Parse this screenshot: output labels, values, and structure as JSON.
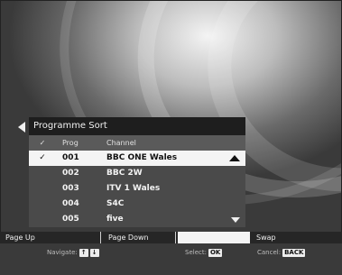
{
  "panel": {
    "title": "Programme Sort",
    "columns": {
      "check": "✓",
      "prog": "Prog",
      "channel": "Channel"
    },
    "rows": [
      {
        "check": "✓",
        "prog": "001",
        "channel": "BBC ONE Wales",
        "selected": true
      },
      {
        "check": "",
        "prog": "002",
        "channel": "BBC 2W"
      },
      {
        "check": "",
        "prog": "003",
        "channel": "ITV 1 Wales"
      },
      {
        "check": "",
        "prog": "004",
        "channel": "S4C"
      },
      {
        "check": "",
        "prog": "005",
        "channel": "five"
      }
    ]
  },
  "buttons": {
    "page_up": "Page Up",
    "page_down": "Page Down",
    "blank": "",
    "swap": "Swap"
  },
  "help": {
    "navigate_label": "Navigate:",
    "navigate_up": "↑",
    "navigate_down": "↓",
    "select_label": "Select:",
    "select_key": "OK",
    "cancel_label": "Cancel:",
    "cancel_key": "BACK"
  }
}
